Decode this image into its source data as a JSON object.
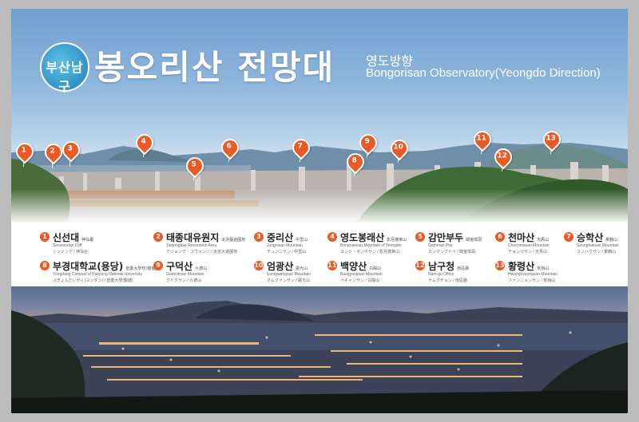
{
  "header": {
    "logo_text": "부산남구",
    "title": "봉오리산 전망대",
    "subtitle_ko": "영도방향",
    "subtitle_en": "Bongorisan Observatory(Yeongdo Direction)"
  },
  "markers": [
    "1",
    "2",
    "3",
    "4",
    "5",
    "6",
    "7",
    "8",
    "9",
    "10",
    "11",
    "12",
    "13"
  ],
  "legend": [
    {
      "n": "1",
      "name": "신선대",
      "hanja": "神仙臺",
      "en": "Sinseondae Cliff",
      "jp": "シンソンデ / 神仙台"
    },
    {
      "n": "2",
      "name": "태종대유원지",
      "hanja": "太宗臺遊園地",
      "en": "Taejongdae Recreation Area",
      "jp": "テジョンデ・ユウォンジ / 太宗大遊園地"
    },
    {
      "n": "3",
      "name": "중리산",
      "hanja": "中里山",
      "en": "Jungnisan Mountain",
      "jp": "チュンニサン / 中里山"
    },
    {
      "n": "4",
      "name": "영도봉래산",
      "hanja": "影島蓬萊山",
      "en": "Bongnaesan Mountain of Yeongdo",
      "jp": "ヨンド・ボンネサン / 影島蓬萊山"
    },
    {
      "n": "5",
      "name": "감만부두",
      "hanja": "戡蠻埠頭",
      "en": "Gamman Pier",
      "jp": "カンマンブドゥ / 戡蠻埠頭"
    },
    {
      "n": "6",
      "name": "천마산",
      "hanja": "天馬山",
      "en": "Cheonmasan Mountain",
      "jp": "チョンマサン / 天馬山"
    },
    {
      "n": "7",
      "name": "승학산",
      "hanja": "乘鶴山",
      "en": "Seunghaksan Mountain",
      "jp": "スンハクサン / 乘鶴山"
    },
    {
      "n": "8",
      "name": "부경대학교(용당)",
      "hanja": "釜慶大學校(龍塘)",
      "en": "Yongdang Campus of Pukyong National University",
      "jp": "ぷぎょんだいがく(ヨンダン) / 釜慶大學(龍塘)"
    },
    {
      "n": "9",
      "name": "구덕산",
      "hanja": "九德山",
      "en": "Gudeoksan Mountain",
      "jp": "クドクサン / 九德山"
    },
    {
      "n": "10",
      "name": "엄광산",
      "hanja": "嚴光山",
      "en": "Eomgwangsan Mountain",
      "jp": "オムグァンサン / 嚴光山"
    },
    {
      "n": "11",
      "name": "백양산",
      "hanja": "白陽山",
      "en": "Baegyangsan Mountain",
      "jp": "ペギャンサン / 白陽山"
    },
    {
      "n": "12",
      "name": "남구청",
      "hanja": "南區廳",
      "en": "Nam-gu Office",
      "jp": "ナムグチョン / 南區廳"
    },
    {
      "n": "13",
      "name": "황령산",
      "hanja": "荒嶺山",
      "en": "Hwangnyeongsan Mountain",
      "jp": "ファンニョンサン / 荒嶺山"
    }
  ],
  "colors": {
    "marker": "#ea5a24",
    "frame": "#bcbcbc"
  }
}
